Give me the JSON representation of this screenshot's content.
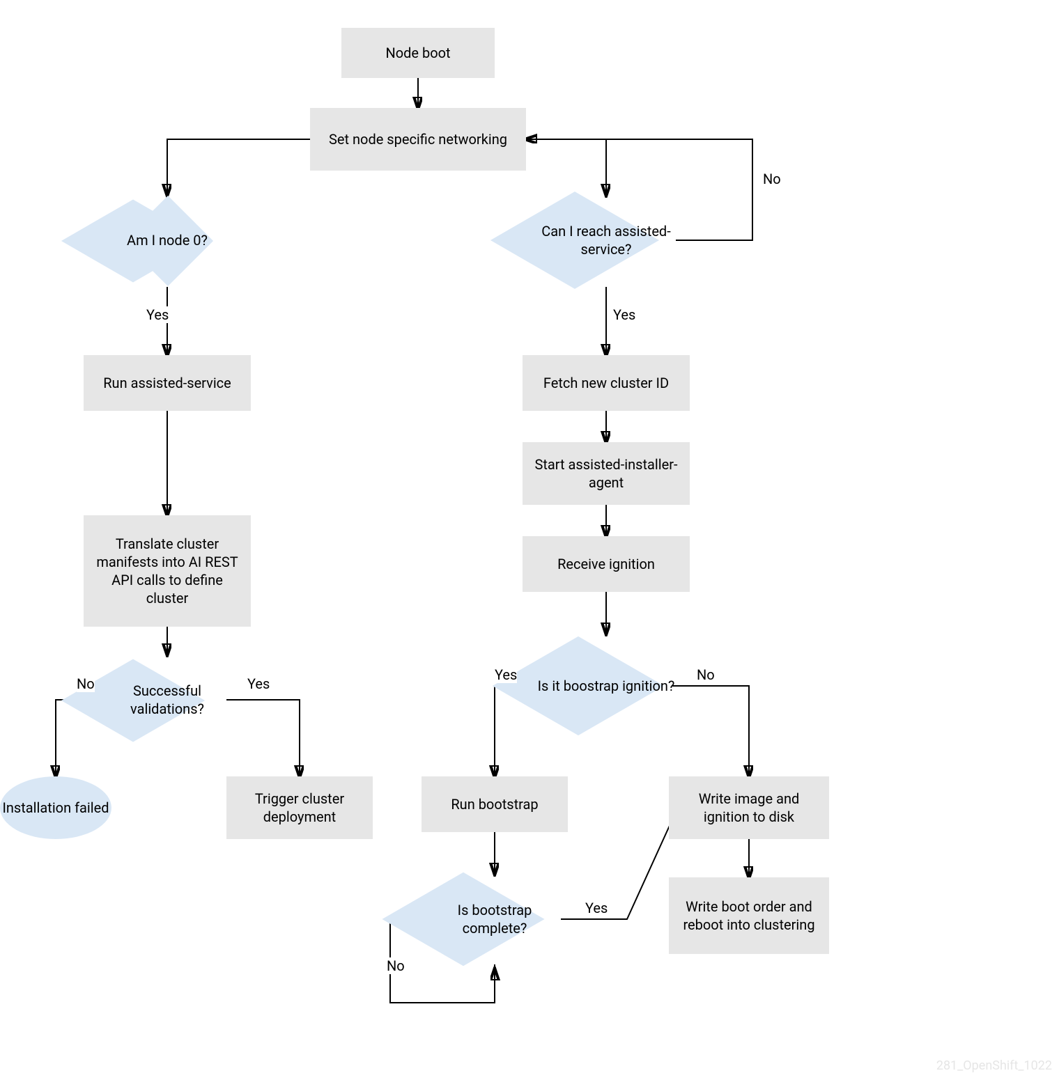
{
  "watermark": "281_OpenShift_1022",
  "nodes": {
    "node_boot": "Node boot",
    "set_networking": "Set node specific networking",
    "am_i_node0": "Am I node 0?",
    "can_reach": "Can I reach assisted-service?",
    "run_assisted": "Run assisted-service",
    "translate": "Translate cluster manifests into AI REST API calls to define cluster",
    "validations": "Successful validations?",
    "install_failed": "Installation failed",
    "trigger_deploy": "Trigger cluster deployment",
    "fetch_cluster_id": "Fetch new cluster ID",
    "start_agent": "Start assisted-installer-agent",
    "receive_ignition": "Receive ignition",
    "is_bootstrap_ign": "Is it boostrap ignition?",
    "run_bootstrap": "Run bootstrap",
    "bootstrap_complete": "Is bootstrap complete?",
    "write_image": "Write image and ignition to disk",
    "write_boot_order": "Write boot order and reboot into clustering"
  },
  "labels": {
    "yes": "Yes",
    "no": "No"
  }
}
